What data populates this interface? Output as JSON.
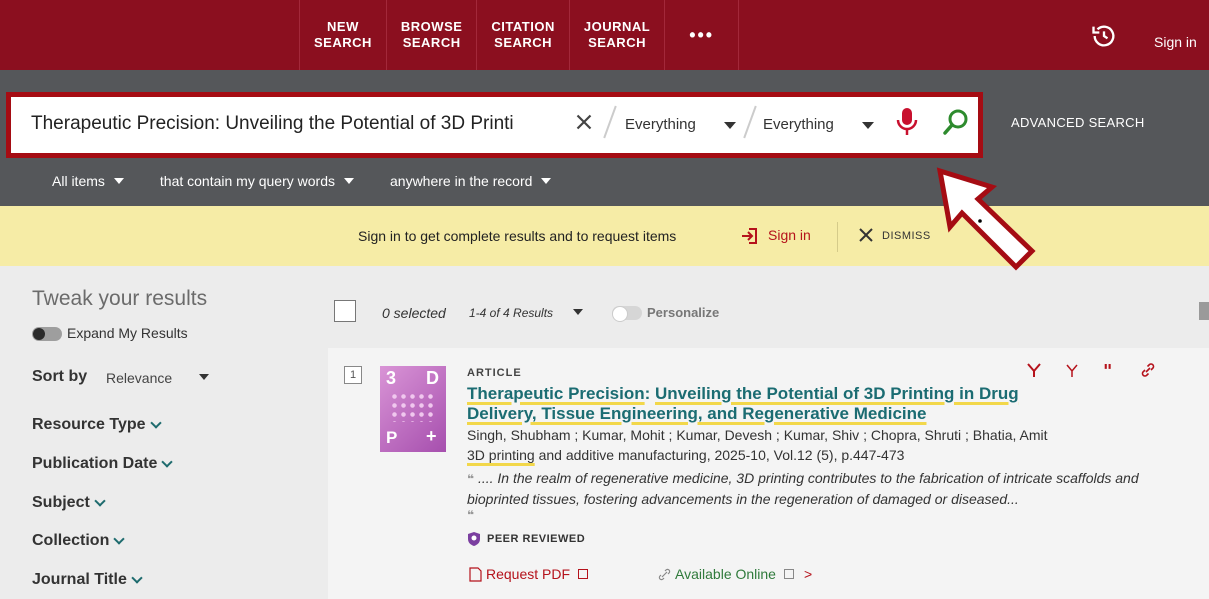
{
  "nav": {
    "items": [
      {
        "line1": "NEW",
        "line2": "SEARCH"
      },
      {
        "line1": "BROWSE",
        "line2": "SEARCH"
      },
      {
        "line1": "CITATION",
        "line2": "SEARCH"
      },
      {
        "line1": "JOURNAL",
        "line2": "SEARCH"
      }
    ],
    "more": "•••",
    "sign_in": "Sign in"
  },
  "search": {
    "query": "Therapeutic Precision: Unveiling the Potential of 3D Printi",
    "scope1": "Everything",
    "scope2": "Everything",
    "advanced": "ADVANCED SEARCH"
  },
  "filters": {
    "items": [
      "All items",
      "that contain my query words",
      "anywhere in the record"
    ]
  },
  "banner": {
    "message": "Sign in to get complete results and to request items",
    "sign_in": "Sign in",
    "dismiss": "DISMISS"
  },
  "sidebar": {
    "title": "Tweak your results",
    "expand": "Expand My Results",
    "sort_label": "Sort by",
    "sort_value": "Relevance",
    "facets": [
      "Resource Type",
      "Publication Date",
      "Subject",
      "Collection",
      "Journal Title"
    ]
  },
  "results": {
    "selected": "0 selected",
    "count": "1-4 of 4 Results",
    "personalize": "Personalize"
  },
  "result": {
    "number": "1",
    "type": "ARTICLE",
    "title_parts": [
      {
        "text": "Therapeutic Precision",
        "hl": true
      },
      {
        "text": ": ",
        "hl": false
      },
      {
        "text": "Unveiling the Potential of 3D Printing in Drug",
        "hl": true
      },
      {
        "text": " ",
        "hl": false
      },
      {
        "text": "Delivery, Tissue Engineering, and Regenerative Medicine",
        "hl": true
      }
    ],
    "authors": "Singh, Shubham ; Kumar, Mohit ; Kumar, Devesh ; Kumar, Shiv ; Chopra, Shruti ; Bhatia, Amit",
    "source_hl": "3D printing",
    "source_rest": " and additive manufacturing, 2025-10, Vol.12 (5), p.447-473",
    "snippet": ".... In the realm of regenerative medicine, 3D printing contributes to the fabrication of intricate scaffolds and bioprinted tissues, fostering advancements in the regeneration of damaged or diseased...",
    "quote_open": "❝",
    "quote_close": "❝",
    "peer_reviewed": "PEER REVIEWED",
    "request_pdf": "Request PDF",
    "available_online": "Available Online",
    "thumb_text": {
      "a": "3",
      "b": "D",
      "c": "P",
      "d": "+"
    }
  },
  "colors": {
    "brand": "#8b0f1f",
    "link": "#1b6c72",
    "accent_red": "#b5121b",
    "green": "#2f7a3b"
  }
}
